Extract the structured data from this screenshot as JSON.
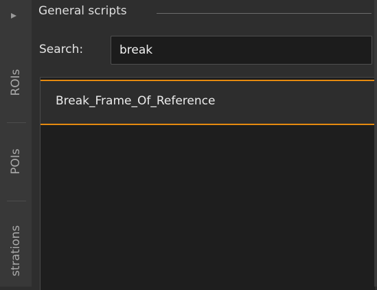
{
  "side_rail": {
    "tabs": [
      {
        "label": "ROIs"
      },
      {
        "label": "POIs"
      },
      {
        "label": "strations"
      }
    ]
  },
  "group": {
    "title": "General scripts"
  },
  "search": {
    "label": "Search:",
    "value": "break"
  },
  "results": {
    "items": [
      {
        "label": "Break_Frame_Of_Reference",
        "selected": true
      }
    ]
  },
  "colors": {
    "selection_accent": "#e68a0f",
    "panel_background": "#1e1e1e",
    "background": "#2e2e2e"
  },
  "icons": {
    "expand": "triangle-right-icon"
  }
}
